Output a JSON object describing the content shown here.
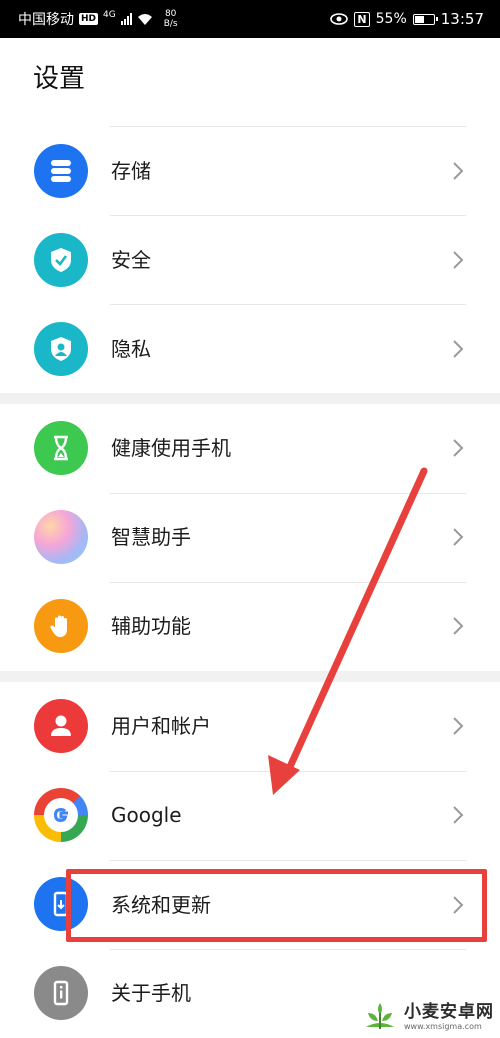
{
  "status_bar": {
    "carrier": "中国移动",
    "hd": "HD",
    "network": "4G",
    "speed_value": "80",
    "speed_unit": "B/s",
    "nfc": "N",
    "battery_percent": "55%",
    "battery_level": 0.55,
    "time": "13:57"
  },
  "page": {
    "title": "设置"
  },
  "items": [
    {
      "label": "存储",
      "icon": "storage-icon",
      "color": "#1e74f0"
    },
    {
      "label": "安全",
      "icon": "shield-check-icon",
      "color": "#19b7c7"
    },
    {
      "label": "隐私",
      "icon": "privacy-icon",
      "color": "#19b7c7"
    },
    {
      "label": "健康使用手机",
      "icon": "hourglass-icon",
      "color": "#3dc84f"
    },
    {
      "label": "智慧助手",
      "icon": "smart-assistant-icon",
      "color": "#c6a8f0"
    },
    {
      "label": "辅助功能",
      "icon": "hand-icon",
      "color": "#f79a12"
    },
    {
      "label": "用户和帐户",
      "icon": "user-icon",
      "color": "#ec3a3a"
    },
    {
      "label": "Google",
      "icon": "google-icon",
      "color": "#ffffff"
    },
    {
      "label": "系统和更新",
      "icon": "system-update-icon",
      "color": "#1e74f0"
    },
    {
      "label": "关于手机",
      "icon": "about-phone-icon",
      "color": "#8a8a8a"
    }
  ],
  "annotation": {
    "color": "#e8413d"
  },
  "watermark": {
    "title": "小麦安卓网",
    "url": "www.xmsigma.com"
  }
}
